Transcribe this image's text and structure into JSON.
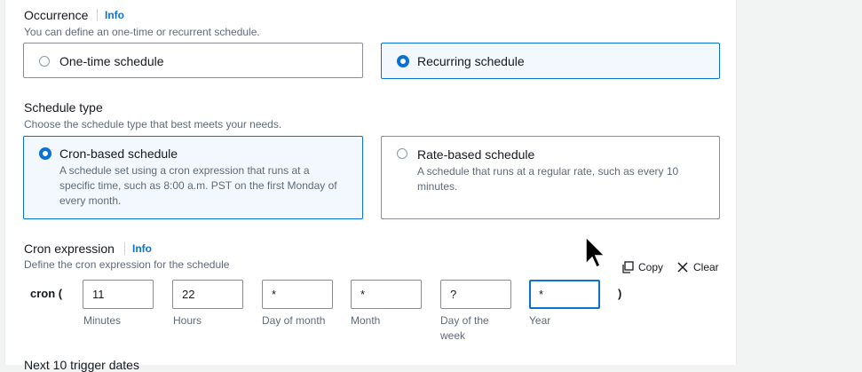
{
  "occurrence": {
    "label": "Occurrence",
    "info": "Info",
    "description": "You can define an one-time or recurrent schedule.",
    "options": [
      {
        "label": "One-time schedule",
        "selected": false
      },
      {
        "label": "Recurring schedule",
        "selected": true
      }
    ]
  },
  "schedule_type": {
    "label": "Schedule type",
    "description": "Choose the schedule type that best meets your needs.",
    "options": [
      {
        "title": "Cron-based schedule",
        "description": "A schedule set using a cron expression that runs at a specific time, such as 8:00 a.m. PST on the first Monday of every month.",
        "selected": true
      },
      {
        "title": "Rate-based schedule",
        "description": "A schedule that runs at a regular rate, such as every 10 minutes.",
        "selected": false
      }
    ]
  },
  "cron": {
    "label": "Cron expression",
    "info": "Info",
    "description": "Define the cron expression for the schedule",
    "prefix": "cron (",
    "suffix": ")",
    "copy_label": "Copy",
    "clear_label": "Clear",
    "fields": [
      {
        "value": "11",
        "label": "Minutes"
      },
      {
        "value": "22",
        "label": "Hours"
      },
      {
        "value": "*",
        "label": "Day of month"
      },
      {
        "value": "*",
        "label": "Month"
      },
      {
        "value": "?",
        "label": "Day of the week"
      },
      {
        "value": "*",
        "label": "Year"
      }
    ]
  },
  "next_section_partial": "Next 10 trigger dates",
  "colors": {
    "accent": "#0972d3",
    "selected_bg": "#f2f8fd",
    "muted": "#5f6b7a"
  }
}
